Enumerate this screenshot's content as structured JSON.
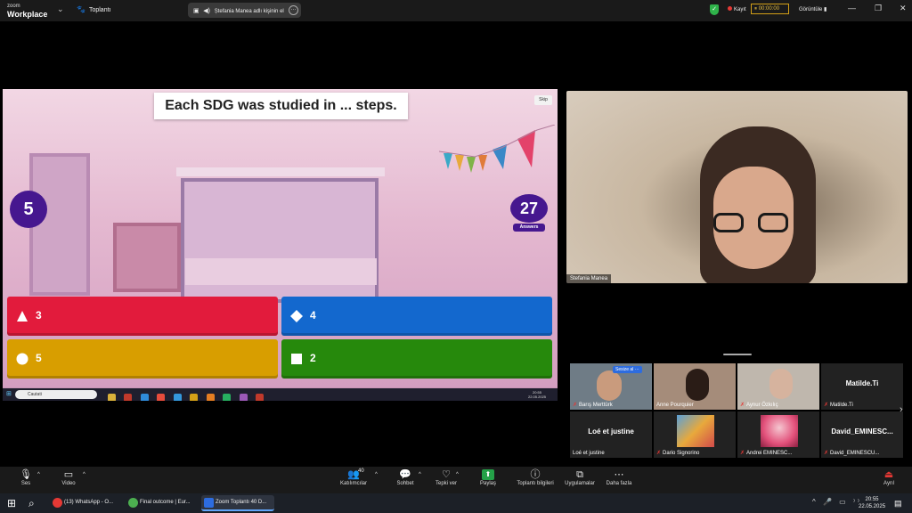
{
  "topbar": {
    "logo_small": "zoom",
    "logo_big": "Workplace",
    "meeting_label": "Toplantı",
    "speaking_label": "Ștefania Manea adlı kişinin el",
    "recording_label": "Kayıt",
    "timer": "00:00:00",
    "view_label": "Görüntüle"
  },
  "share": {
    "question": "Each SDG was studied in ... steps.",
    "skip_label": "Skip",
    "timer_value": "5",
    "answers_count": "27",
    "answers_label": "Answers",
    "options": [
      {
        "shape": "triangle",
        "label": "3",
        "color": "#e21b3c"
      },
      {
        "shape": "diamond",
        "label": "4",
        "color": "#1368ce"
      },
      {
        "shape": "circle",
        "label": "5",
        "color": "#d89e00"
      },
      {
        "shape": "square",
        "label": "2",
        "color": "#26890c"
      }
    ],
    "inner_search": "Cautati",
    "inner_clock_time": "20:55",
    "inner_clock_date": "22.05.2025"
  },
  "speaker": {
    "name": "Stefania Manea"
  },
  "gallery": {
    "unmute_label": "Sesize al",
    "tiles": [
      {
        "name": "Barış Merttürk"
      },
      {
        "name": "Anne Pourquier"
      },
      {
        "name": "Aynur Özkılıç"
      },
      {
        "name": "Matilde.Ti",
        "center": "Matilde.Ti"
      },
      {
        "name": "Loé et justine",
        "center": "Loé et justine"
      },
      {
        "name": "Dario Signorino"
      },
      {
        "name": "Andrei EMINESC..."
      },
      {
        "name": "David_EMINESCU...",
        "center": "David_EMINESC..."
      }
    ]
  },
  "toolbar": {
    "mute": "Ses",
    "video": "Video",
    "participants": "Katılımcılar",
    "participants_count": "40",
    "chat": "Sohbet",
    "react": "Tepki ver",
    "share": "Paylaş",
    "info": "Toplantı bilgileri",
    "apps": "Uygulamalar",
    "more": "Daha fazla",
    "leave": "Ayrıl"
  },
  "taskbar": {
    "apps": [
      {
        "label": "(13) WhatsApp - O...",
        "color": "#e53935"
      },
      {
        "label": "Final outcome | Eur...",
        "color": "#4caf50"
      },
      {
        "label": "Zoom Toplantı 40 D...",
        "color": "#2d6cdf"
      }
    ],
    "time": "20:55",
    "date": "22.05.2025"
  }
}
